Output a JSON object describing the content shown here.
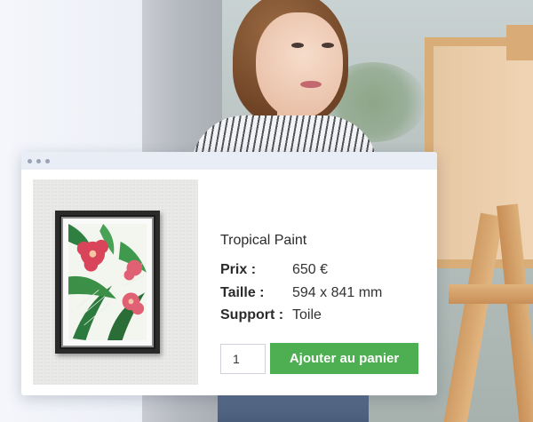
{
  "window": {
    "dots": 3
  },
  "product": {
    "title": "Tropical Paint",
    "specs": [
      {
        "label": "Prix :",
        "value": "650 €"
      },
      {
        "label": "Taille :",
        "value": "594 x 841 mm"
      },
      {
        "label": "Support :",
        "value": "Toile"
      }
    ],
    "quantity": "1",
    "add_to_cart_label": "Ajouter au panier"
  },
  "colors": {
    "button": "#4eae52",
    "titlebar": "#e9edf6"
  },
  "icons": [
    "window-dot-icon"
  ]
}
